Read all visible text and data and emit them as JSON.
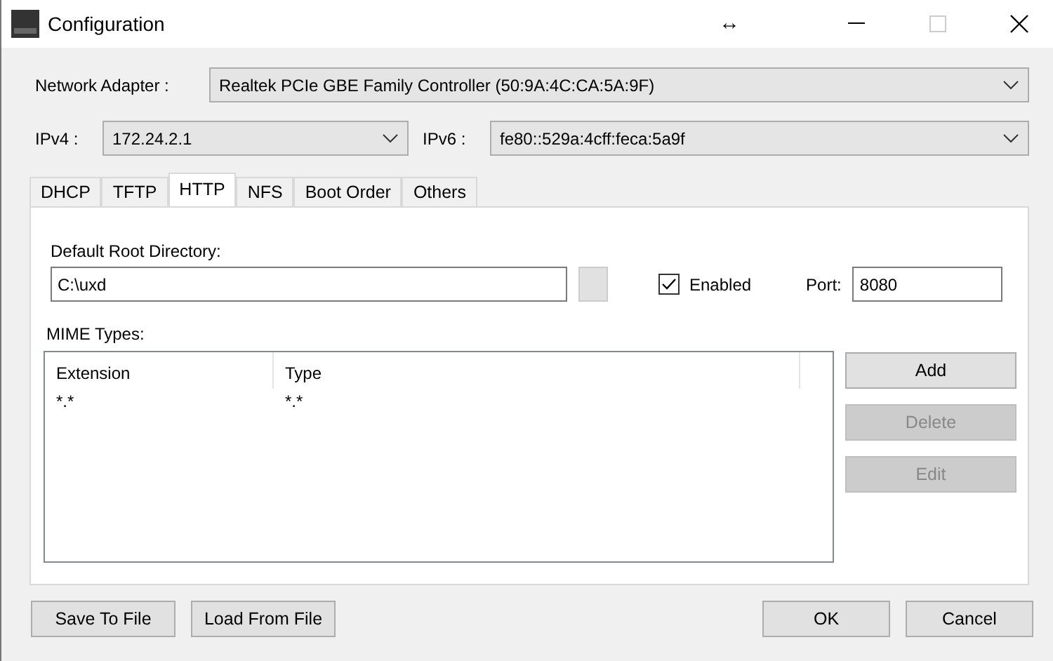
{
  "window": {
    "title": "Configuration",
    "resize_glyph": "↔"
  },
  "network_adapter": {
    "label": "Network Adapter :",
    "value": "Realtek PCIe GBE Family Controller (50:9A:4C:CA:5A:9F)"
  },
  "ipv4": {
    "label": "IPv4 :",
    "value": "172.24.2.1"
  },
  "ipv6": {
    "label": "IPv6 :",
    "value": "fe80::529a:4cff:feca:5a9f"
  },
  "tabs": [
    {
      "label": "DHCP",
      "selected": false
    },
    {
      "label": "TFTP",
      "selected": false
    },
    {
      "label": "HTTP",
      "selected": true
    },
    {
      "label": "NFS",
      "selected": false
    },
    {
      "label": "Boot Order",
      "selected": false
    },
    {
      "label": "Others",
      "selected": false
    }
  ],
  "http": {
    "root_label": "Default Root Directory:",
    "root_value": "C:\\uxd",
    "enabled": {
      "label": "Enabled",
      "checked": true
    },
    "port_label": "Port:",
    "port_value": "8080",
    "mime_label": "MIME Types:",
    "mime_table": {
      "columns": [
        "Extension",
        "Type"
      ],
      "rows": [
        [
          "*.*",
          "*.*"
        ]
      ]
    },
    "side_buttons": [
      {
        "label": "Add",
        "disabled": false
      },
      {
        "label": "Delete",
        "disabled": true
      },
      {
        "label": "Edit",
        "disabled": true
      }
    ]
  },
  "footer_left": [
    "Save To File",
    "Load From File"
  ],
  "footer_right": [
    "OK",
    "Cancel"
  ]
}
